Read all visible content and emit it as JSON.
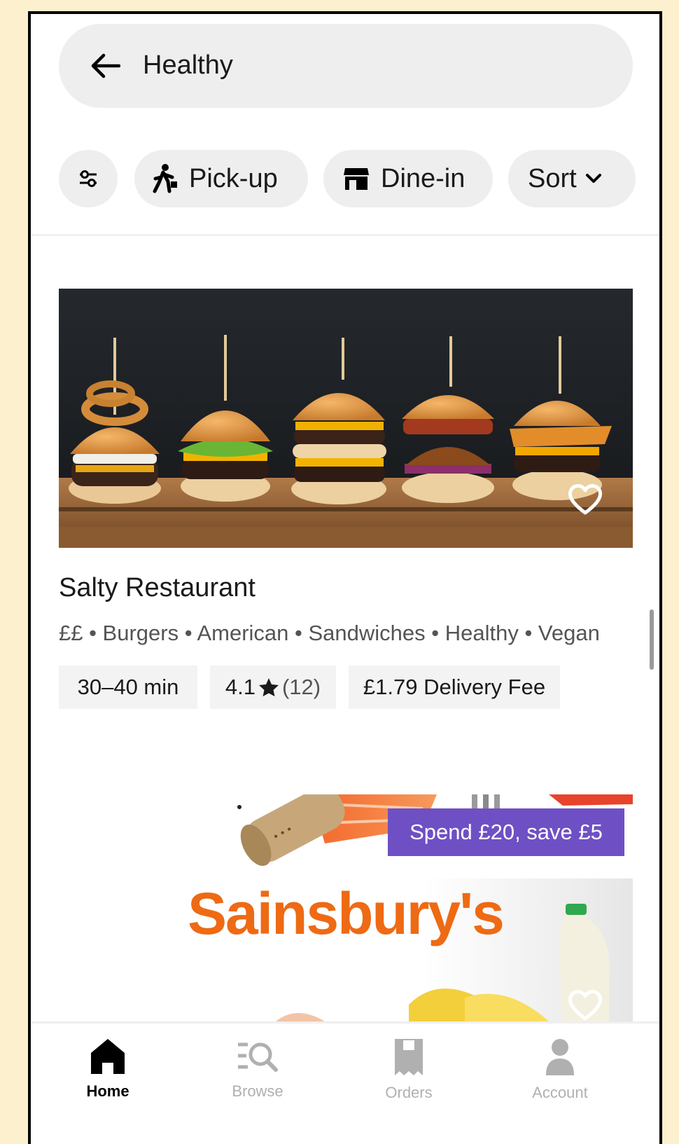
{
  "search": {
    "query": "Healthy"
  },
  "filters": {
    "pickup_label": "Pick-up",
    "dinein_label": "Dine-in",
    "sort_label": "Sort"
  },
  "restaurants": [
    {
      "name": "Salty Restaurant",
      "tags": "££ • Burgers • American • Sandwiches • Healthy • Vegan",
      "time": "30–40 min",
      "rating": "4.1",
      "rating_count": "(12)",
      "delivery_fee": "£1.79 Delivery Fee"
    }
  ],
  "store": {
    "name": "Sainsbury's",
    "promo": "Spend £20, save £5"
  },
  "nav": {
    "home": "Home",
    "browse": "Browse",
    "orders": "Orders",
    "account": "Account"
  },
  "colors": {
    "page_background": "#fdf0cf",
    "chip_background": "#eeeeee",
    "promo_purple": "#6e50c4",
    "sainsburys_orange": "#ee6a14"
  }
}
